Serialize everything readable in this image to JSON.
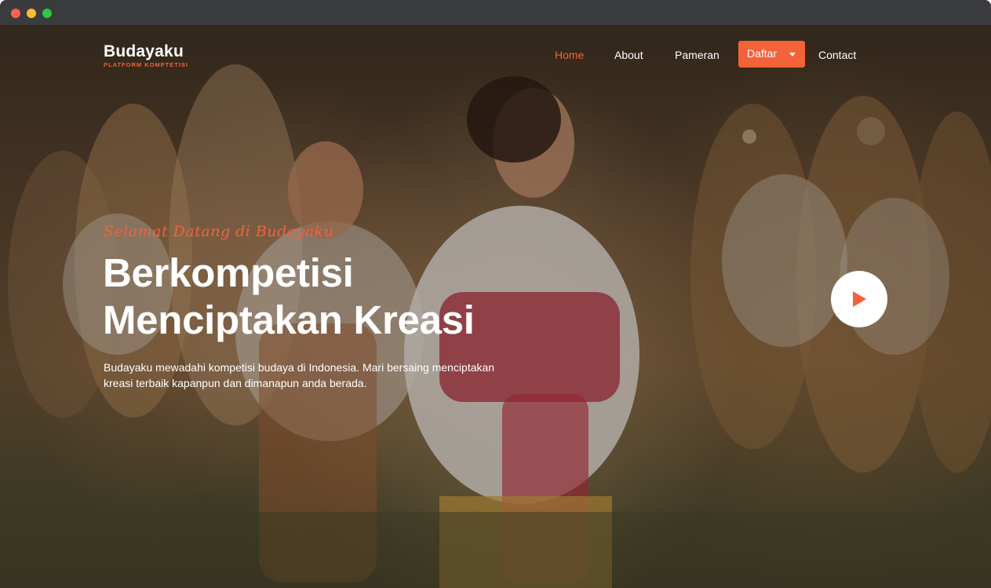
{
  "window": {
    "controls": [
      "close",
      "minimize",
      "maximize"
    ]
  },
  "brand": {
    "name": "Budayaku",
    "tagline": "PLATFORM KOMPTETISI"
  },
  "nav": {
    "items": [
      {
        "label": "Home",
        "active": true
      },
      {
        "label": "About",
        "active": false
      },
      {
        "label": "Pameran",
        "active": false
      }
    ],
    "dropdown": {
      "label": "Daftar"
    },
    "contact": {
      "label": "Contact"
    }
  },
  "hero": {
    "greeting": "Selamat Datang di Budayaku",
    "headline_line1": "Berkompetisi",
    "headline_line2": "Menciptakan Kreasi",
    "description": "Budayaku mewadahi kompetisi budaya di Indonesia. Mari bersaing menciptakan kreasi terbaik kapanpun dan dimanapun anda berada.",
    "background": "photo of Balinese dancers in traditional costume",
    "play_icon": "play-icon"
  },
  "colors": {
    "accent": "#f4623a",
    "text": "#ffffff"
  }
}
